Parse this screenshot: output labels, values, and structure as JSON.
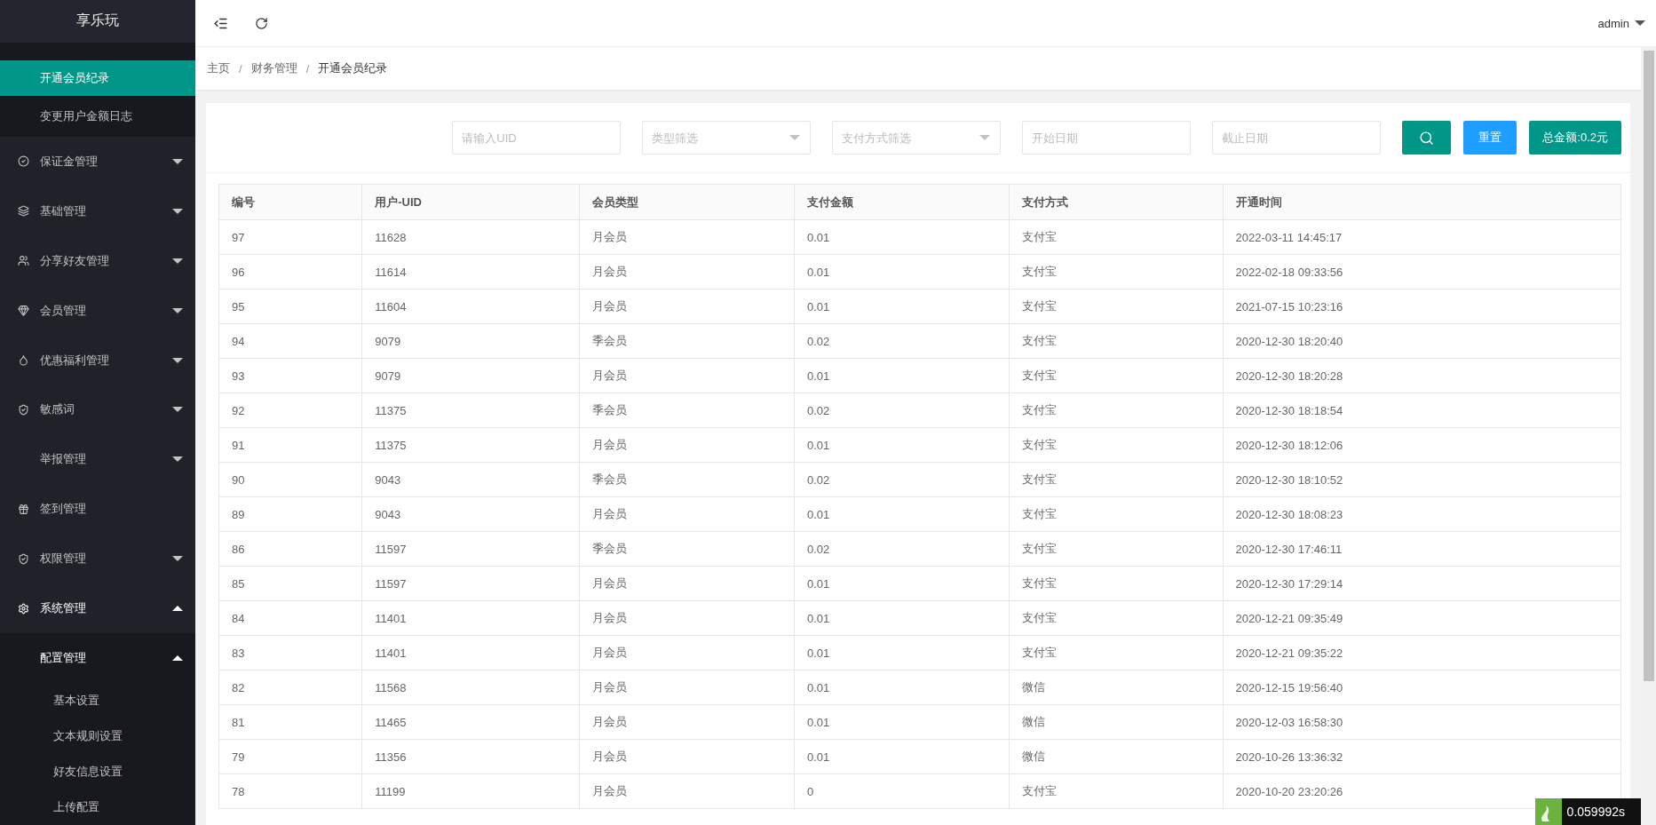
{
  "sidebar": {
    "title": "享乐玩",
    "sub_items": [
      {
        "label": "开通会员纪录",
        "selected": true
      },
      {
        "label": "变更用户金额日志",
        "selected": false
      }
    ],
    "items": [
      {
        "label": "保证金管理",
        "expanded": false
      },
      {
        "label": "基础管理",
        "expanded": false
      },
      {
        "label": "分享好友管理",
        "expanded": false
      },
      {
        "label": "会员管理",
        "expanded": false
      },
      {
        "label": "优惠福利管理",
        "expanded": false
      },
      {
        "label": "敏感词",
        "expanded": false
      },
      {
        "label": "举报管理",
        "expanded": false
      },
      {
        "label": "签到管理"
      },
      {
        "label": "权限管理",
        "expanded": false
      },
      {
        "label": "系统管理",
        "expanded": true,
        "children": [
          {
            "label": "配置管理",
            "expanded": true,
            "children": [
              {
                "label": "基本设置"
              },
              {
                "label": "文本规则设置"
              },
              {
                "label": "好友信息设置"
              },
              {
                "label": "上传配置"
              }
            ]
          }
        ]
      }
    ]
  },
  "header": {
    "user": "admin"
  },
  "breadcrumb": {
    "items": [
      "主页",
      "财务管理",
      "开通会员纪录"
    ],
    "separators": [
      "/",
      "/"
    ]
  },
  "filters": {
    "uid": {
      "placeholder": "请输入UID"
    },
    "type": {
      "placeholder": "类型筛选"
    },
    "payment": {
      "placeholder": "支付方式筛选"
    },
    "start_date": {
      "placeholder": "开始日期"
    },
    "end_date": {
      "placeholder": "截止日期"
    },
    "reset": "重置",
    "total": "总金额:0.2元"
  },
  "table": {
    "columns": [
      "编号",
      "用户-UID",
      "会员类型",
      "支付金额",
      "支付方式",
      "开通时间"
    ],
    "rows": [
      [
        "97",
        "11628",
        "月会员",
        "0.01",
        "支付宝",
        "2022-03-11 14:45:17"
      ],
      [
        "96",
        "11614",
        "月会员",
        "0.01",
        "支付宝",
        "2022-02-18 09:33:56"
      ],
      [
        "95",
        "11604",
        "月会员",
        "0.01",
        "支付宝",
        "2021-07-15 10:23:16"
      ],
      [
        "94",
        "9079",
        "季会员",
        "0.02",
        "支付宝",
        "2020-12-30 18:20:40"
      ],
      [
        "93",
        "9079",
        "月会员",
        "0.01",
        "支付宝",
        "2020-12-30 18:20:28"
      ],
      [
        "92",
        "11375",
        "季会员",
        "0.02",
        "支付宝",
        "2020-12-30 18:18:54"
      ],
      [
        "91",
        "11375",
        "月会员",
        "0.01",
        "支付宝",
        "2020-12-30 18:12:06"
      ],
      [
        "90",
        "9043",
        "季会员",
        "0.02",
        "支付宝",
        "2020-12-30 18:10:52"
      ],
      [
        "89",
        "9043",
        "月会员",
        "0.01",
        "支付宝",
        "2020-12-30 18:08:23"
      ],
      [
        "86",
        "11597",
        "季会员",
        "0.02",
        "支付宝",
        "2020-12-30 17:46:11"
      ],
      [
        "85",
        "11597",
        "月会员",
        "0.01",
        "支付宝",
        "2020-12-30 17:29:14"
      ],
      [
        "84",
        "11401",
        "月会员",
        "0.01",
        "支付宝",
        "2020-12-21 09:35:49"
      ],
      [
        "83",
        "11401",
        "月会员",
        "0.01",
        "支付宝",
        "2020-12-21 09:35:22"
      ],
      [
        "82",
        "11568",
        "月会员",
        "0.01",
        "微信",
        "2020-12-15 19:56:40"
      ],
      [
        "81",
        "11465",
        "月会员",
        "0.01",
        "微信",
        "2020-12-03 16:58:30"
      ],
      [
        "79",
        "11356",
        "月会员",
        "0.01",
        "微信",
        "2020-10-26 13:36:32"
      ],
      [
        "78",
        "11199",
        "月会员",
        "0",
        "支付宝",
        "2020-10-20 23:20:26"
      ]
    ]
  },
  "debug_badge": {
    "time": "0.059992s"
  }
}
